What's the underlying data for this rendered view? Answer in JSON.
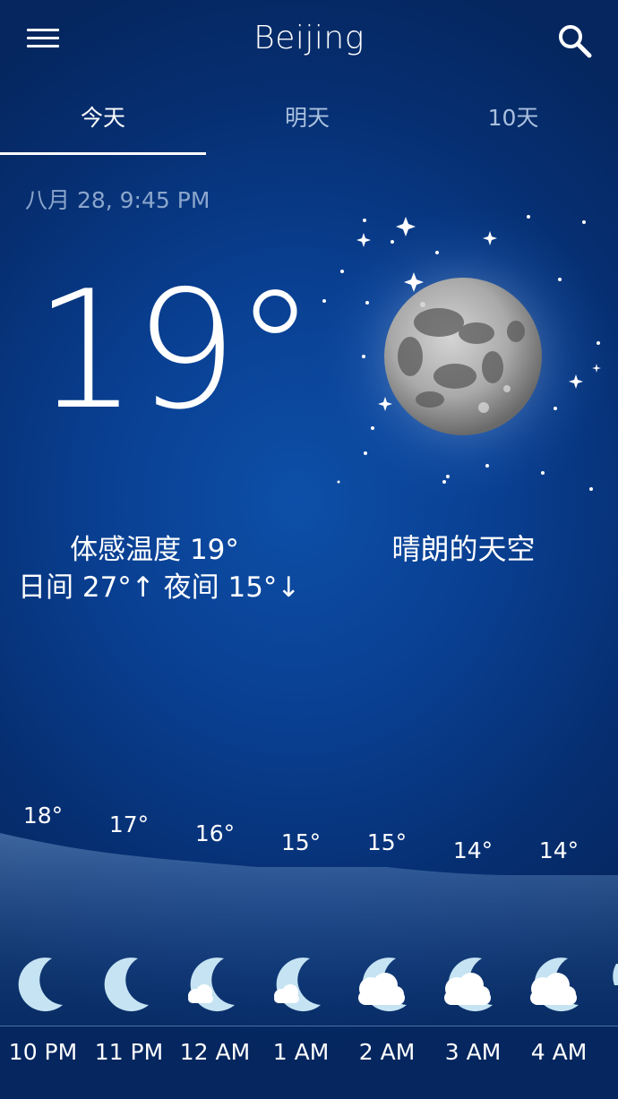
{
  "header": {
    "city": "Beijing",
    "menu_icon": "menu-icon",
    "search_icon": "search-icon"
  },
  "tabs": [
    {
      "label": "今天",
      "active": true
    },
    {
      "label": "明天",
      "active": false
    },
    {
      "label": "10天",
      "active": false
    }
  ],
  "current": {
    "datetime": "八月 28, 9:45 PM",
    "temperature": "19°",
    "feels_like": "体感温度 19°",
    "day_night": "日间 27°↑  夜间 15°↓",
    "condition": "晴朗的天空",
    "condition_icon": "moon-icon"
  },
  "hourly": [
    {
      "time": "10 PM",
      "temp": "18°",
      "icon": "moon-icon"
    },
    {
      "time": "11 PM",
      "temp": "17°",
      "icon": "moon-icon"
    },
    {
      "time": "12 AM",
      "temp": "16°",
      "icon": "moon-small-cloud-icon"
    },
    {
      "time": "1 AM",
      "temp": "15°",
      "icon": "moon-small-cloud-icon"
    },
    {
      "time": "2 AM",
      "temp": "15°",
      "icon": "moon-cloud-icon"
    },
    {
      "time": "3 AM",
      "temp": "14°",
      "icon": "moon-cloud-icon"
    },
    {
      "time": "4 AM",
      "temp": "14°",
      "icon": "moon-cloud-icon"
    }
  ],
  "colors": {
    "background": "#093f91",
    "icon_fill": "#c5e3f2",
    "cloud": "#ffffff"
  }
}
